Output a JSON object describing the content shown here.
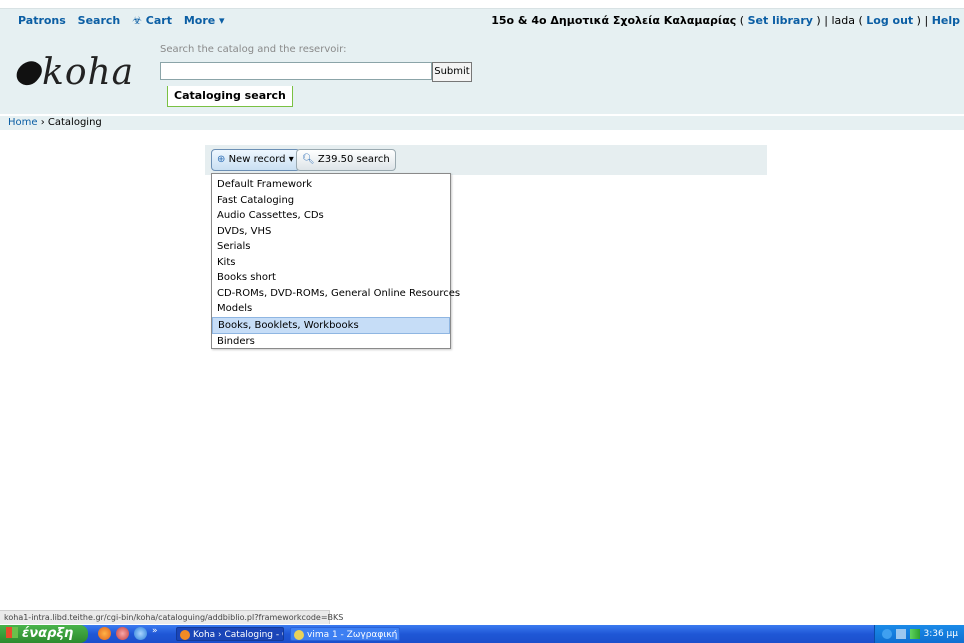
{
  "topnav": {
    "items": [
      "Patrons",
      "Search",
      "☣ Cart",
      "More ▾"
    ]
  },
  "topright": {
    "library_name": "15ο & 4ο Δημοτικά Σχολεία Καλαμαρίας",
    "set_library": "Set library",
    "user": "lada",
    "log_out": "Log out",
    "help": "Help"
  },
  "header": {
    "logo": "koha",
    "search_label": "Search the catalog and the reservoir:",
    "search_value": "",
    "submit_label": "Submit",
    "active_tab": "Cataloging search"
  },
  "breadcrumb": {
    "home": "Home",
    "separator": " › ",
    "current": "Cataloging"
  },
  "toolbar": {
    "new_record_label": "New record ▾",
    "z3950_label": "Z39.50 search"
  },
  "menu": {
    "items": [
      "Default Framework",
      "Fast Cataloging",
      "Audio Cassettes, CDs",
      "DVDs, VHS",
      "Serials",
      "Kits",
      "Books short",
      "CD-ROMs, DVD-ROMs, General Online Resources",
      "Models",
      "Books, Booklets, Workbooks",
      "Binders"
    ],
    "highlighted": "Books, Booklets, Workbooks"
  },
  "statusbar": {
    "url": "koha1-intra.libd.teithe.gr/cgi-bin/koha/cataloguing/addbiblio.pl?frameworkcode=BKS"
  },
  "taskbar": {
    "start_label": "έναρξη",
    "tasks": [
      "Koha › Cataloging - G...",
      "vima 1 - Ζωγραφική"
    ],
    "clock": "3:36 μμ"
  },
  "colors": {
    "link": "#0b5ea4",
    "header_bg": "#e6f0f2",
    "tab_border": "#7ac143",
    "taskbar": "#1f57d6"
  }
}
